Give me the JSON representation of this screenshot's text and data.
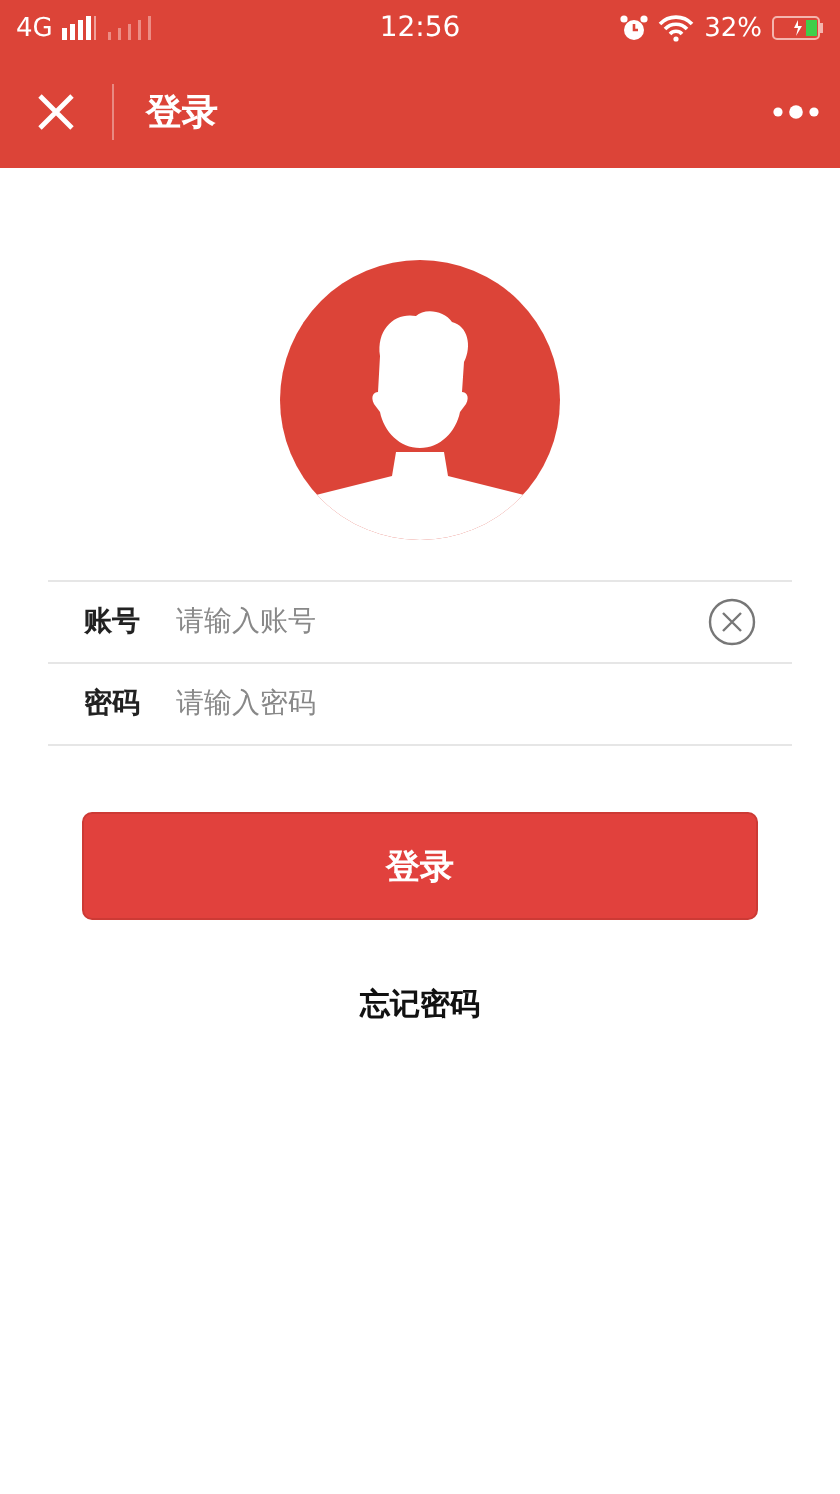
{
  "status_bar": {
    "network": "4G",
    "time": "12:56",
    "battery": "32%"
  },
  "nav": {
    "title": "登录"
  },
  "fields": [
    {
      "label": "账号",
      "placeholder": "请输入账号",
      "clearable": true
    },
    {
      "label": "密码",
      "placeholder": "请输入密码",
      "clearable": false
    }
  ],
  "login_button": "登录",
  "forgot_link": "忘记密码"
}
